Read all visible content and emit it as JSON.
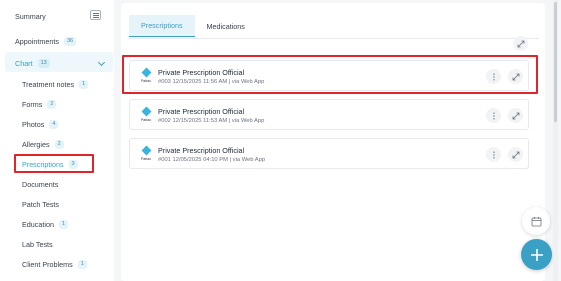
{
  "sidebar": {
    "summary": "Summary",
    "appointments": {
      "label": "Appointments",
      "count": "36"
    },
    "chart": {
      "label": "Chart",
      "count": "13"
    },
    "items": [
      {
        "label": "Treatment notes",
        "count": "1"
      },
      {
        "label": "Forms",
        "count": "2"
      },
      {
        "label": "Photos",
        "count": "4"
      },
      {
        "label": "Allergies",
        "count": "2"
      },
      {
        "label": "Prescriptions",
        "count": "3"
      },
      {
        "label": "Documents",
        "count": ""
      },
      {
        "label": "Patch Tests",
        "count": ""
      },
      {
        "label": "Education",
        "count": "1"
      },
      {
        "label": "Lab Tests",
        "count": ""
      },
      {
        "label": "Client Problems",
        "count": "1"
      }
    ]
  },
  "tabs": [
    "Prescriptions",
    "Medications"
  ],
  "prescriptions": [
    {
      "logo": "Pabau",
      "title": "Private Prescription Official",
      "meta": "#003  12/15/2025 11:56 AM  |  via Web App"
    },
    {
      "logo": "Pabau",
      "title": "Private Prescription Official",
      "meta": "#002  12/15/2025 11:53 AM  |  via Web App"
    },
    {
      "logo": "Pabau",
      "title": "Private Prescription Official",
      "meta": "#001  12/05/2025 04:10 PM  |  via Web App"
    }
  ],
  "colors": {
    "accent": "#3aa0c6",
    "highlight": "#e0242b"
  }
}
